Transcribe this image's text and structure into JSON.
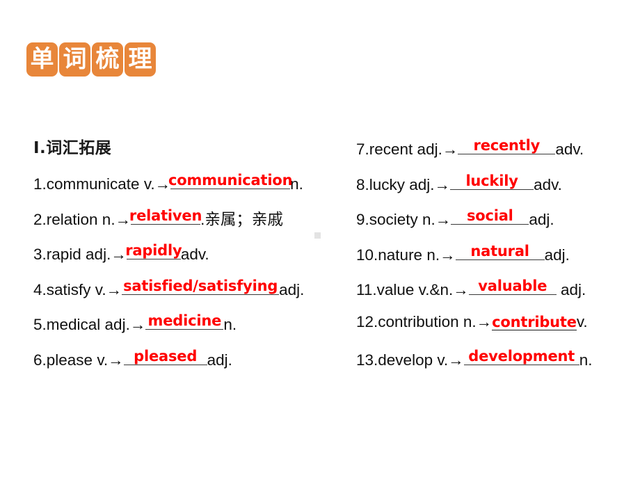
{
  "title_banner": {
    "chars": [
      "单",
      "词",
      "梳",
      "理"
    ],
    "box_color": "#E8863A",
    "text_color": "#FFFFFF"
  },
  "section": {
    "heading": "Ⅰ.词汇拓展"
  },
  "answer_color": "#FF0000",
  "left_column": {
    "items": [
      {
        "stem": "1.communicate v.→",
        "answer": "communication",
        "blank_width": 172,
        "suffix": "n.",
        "gloss": ""
      },
      {
        "stem": "2.relation n.→",
        "answer": "relativen",
        "blank_width": 100,
        "suffix": ".",
        "gloss": "亲属；亲戚"
      },
      {
        "stem": "3.rapid adj.→",
        "answer": "rapidly",
        "blank_width": 78,
        "suffix": "adv.",
        "gloss": ""
      },
      {
        "stem": "4.satisfy v.→",
        "answer": "satisfied/satisfying",
        "blank_width": 226,
        "suffix": "adj.",
        "gloss": ""
      },
      {
        "stem": "5.medical adj.→",
        "answer": "medicine",
        "blank_width": 112,
        "suffix": "n.",
        "gloss": ""
      },
      {
        "stem": "6.please v.→",
        "answer": "pleased",
        "blank_width": 120,
        "suffix": "adj.",
        "gloss": ""
      }
    ]
  },
  "right_column": {
    "items": [
      {
        "stem": "7.recent adj.→",
        "answer": "recently",
        "blank_width": 140,
        "suffix": "adv.",
        "gloss": "",
        "inline": false
      },
      {
        "stem": "8.lucky adj.→",
        "answer": "luckily",
        "blank_width": 120,
        "suffix": "adv.",
        "gloss": "",
        "inline": false
      },
      {
        "stem": "9.society n.→",
        "answer": "social",
        "blank_width": 112,
        "suffix": "adj.",
        "gloss": "",
        "inline": false
      },
      {
        "stem": "10.nature n.→",
        "answer": "natural",
        "blank_width": 128,
        "suffix": "adj.",
        "gloss": "",
        "inline": false
      },
      {
        "stem": "11.value v.&n.→",
        "answer": "valuable",
        "blank_width": 126,
        "suffix": " adj.",
        "gloss": "",
        "inline": false
      },
      {
        "stem": "12.contribution n.→",
        "answer": "contribute",
        "blank_width": 0,
        "suffix": "v.",
        "gloss": "",
        "inline": true
      },
      {
        "stem": "13.develop v.→",
        "answer": "development",
        "blank_width": 166,
        "suffix": "n.",
        "gloss": "",
        "inline": false
      }
    ]
  }
}
